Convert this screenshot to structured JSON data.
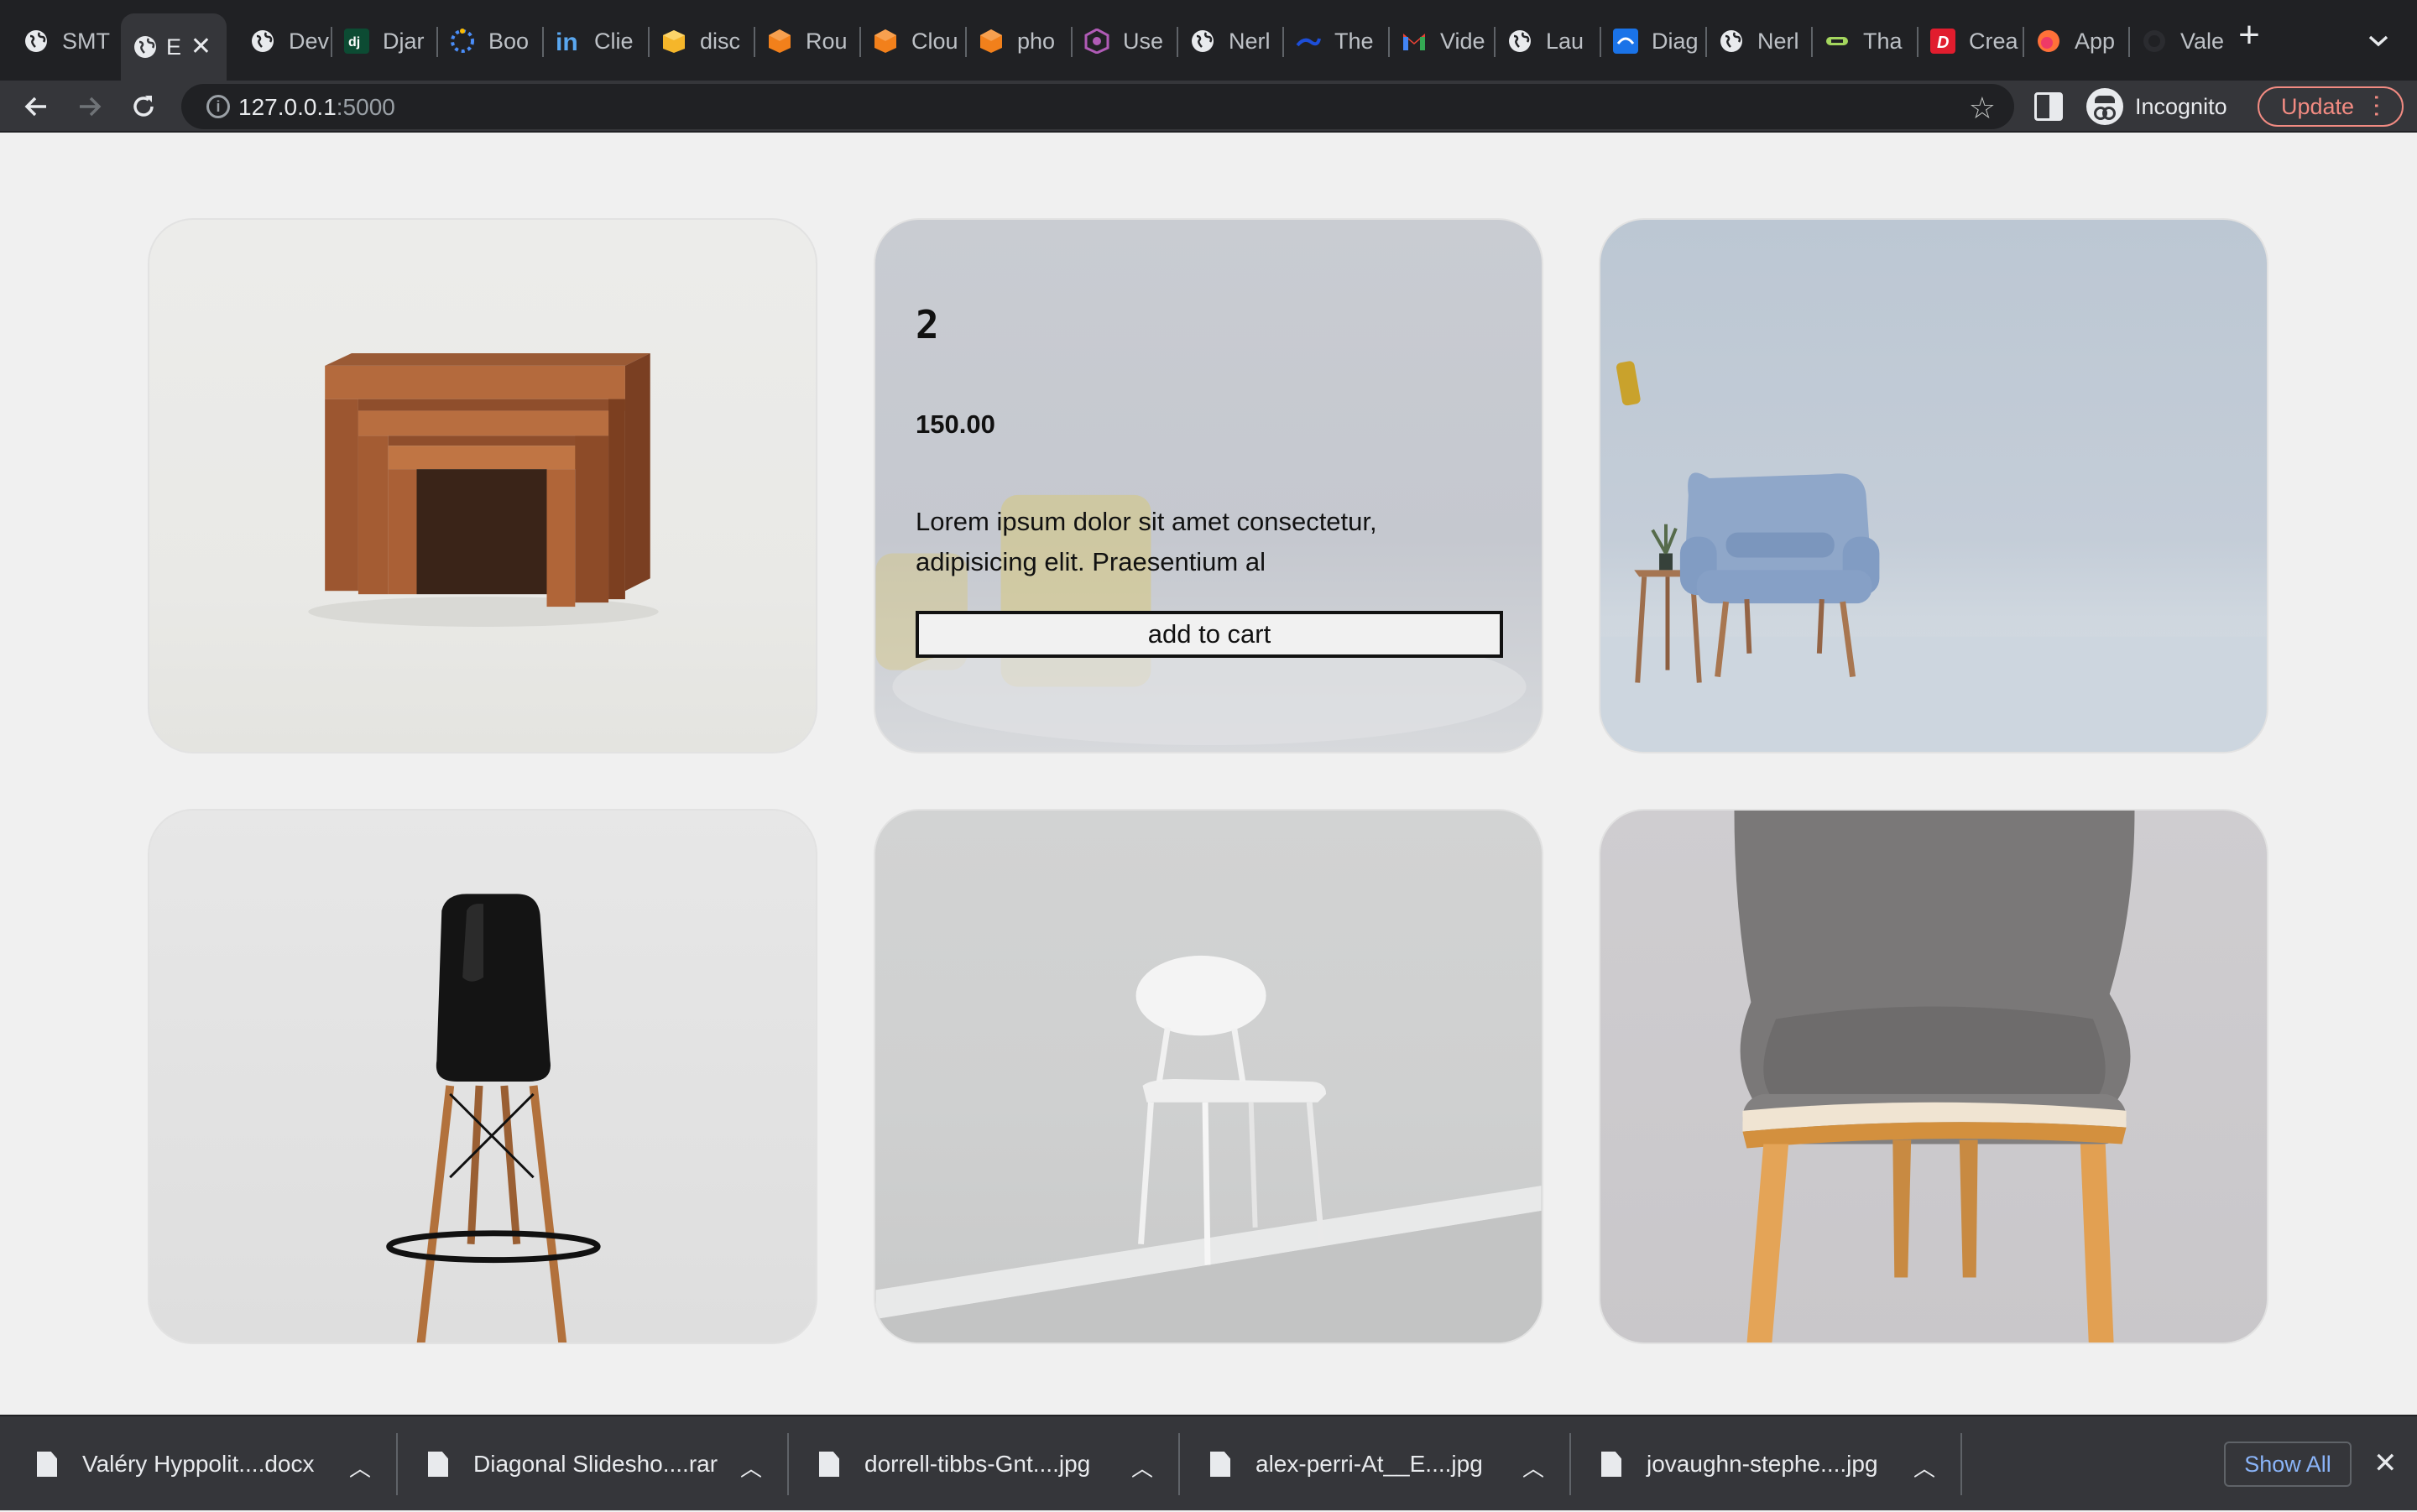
{
  "browser": {
    "tabs": [
      {
        "title": "SMT",
        "icon": "globe-icon"
      },
      {
        "title": "E",
        "icon": "globe-icon",
        "active": true
      },
      {
        "title": "Dev",
        "icon": "globe-icon"
      },
      {
        "title": "Djar",
        "icon": "django-icon"
      },
      {
        "title": "Boo",
        "icon": "loader-icon"
      },
      {
        "title": "Clie",
        "icon": "linkedin-icon"
      },
      {
        "title": "disc",
        "icon": "box-icon"
      },
      {
        "title": "Rou",
        "icon": "cube-icon"
      },
      {
        "title": "Clou",
        "icon": "cube-icon"
      },
      {
        "title": "pho",
        "icon": "cube-icon"
      },
      {
        "title": "Use",
        "icon": "hexagon-icon"
      },
      {
        "title": "Nerl",
        "icon": "globe-icon"
      },
      {
        "title": "The",
        "icon": "wave-icon"
      },
      {
        "title": "Vide",
        "icon": "gmail-icon"
      },
      {
        "title": "Lau",
        "icon": "globe-icon"
      },
      {
        "title": "Diag",
        "icon": "diagram-icon"
      },
      {
        "title": "Nerl",
        "icon": "globe-icon"
      },
      {
        "title": "Tha",
        "icon": "cable-icon"
      },
      {
        "title": "Crea",
        "icon": "d-icon"
      },
      {
        "title": "App",
        "icon": "firefox-icon"
      },
      {
        "title": "Vale",
        "icon": "github-icon"
      }
    ],
    "url_host": "127.0.0.1",
    "url_port": ":5000",
    "profile_label": "Incognito",
    "update_label": "Update"
  },
  "products": {
    "featured": {
      "name": "2",
      "price": "150.00",
      "description": "Lorem ipsum dolor sit amet consectetur, adipisicing elit. Praesentium al",
      "button_label": "add to cart"
    }
  },
  "downloads": {
    "items": [
      {
        "filename": "Valéry Hyppolit....docx"
      },
      {
        "filename": "Diagonal Slidesho....rar"
      },
      {
        "filename": "dorrell-tibbs-Gnt....jpg"
      },
      {
        "filename": "alex-perri-At__E....jpg"
      },
      {
        "filename": "jovaughn-stephe....jpg"
      }
    ],
    "show_all_label": "Show All"
  }
}
